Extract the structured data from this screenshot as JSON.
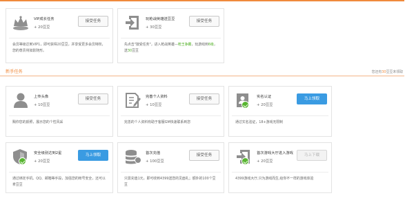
{
  "header": {
    "accent_color": "#f08a3c"
  },
  "top_tasks": [
    {
      "icon": "vip-crown-icon",
      "name": "VIP成长任务",
      "reward": "+ 20豆豆",
      "button": "接受任务",
      "desc": "会员等级达到VIP1，即可获得20豆豆，并享受更多会员特权，您的尊贵将如影随形。"
    },
    {
      "icon": "login-arrow-icon",
      "name": "玩枪战英雄送豆豆",
      "reward": "+ 30豆豆",
      "button": "接受任务",
      "desc_parts": [
        "先点击\"接受任务\"，进入枪战英雄—",
        "枪王争霸",
        "，玩游戏到",
        "6级",
        "，送",
        "30",
        "豆豆"
      ]
    }
  ],
  "newbie": {
    "title": "新手任务",
    "note_prefix": "您还有",
    "note_count": "30",
    "note_suffix": "豆豆未领取"
  },
  "tasks": [
    {
      "icon": "user-avatar-icon",
      "name": "上传头像",
      "reward": "+ 10豆豆",
      "button": "接受任务",
      "button_style": "default",
      "desc": "赐你您的颜照，展示您的个性风采"
    },
    {
      "icon": "edit-document-icon",
      "name": "完善个人资料",
      "reward": "+ 10豆豆",
      "button": "接受任务",
      "button_style": "default",
      "desc": "完善的个人资料有助于客服GM快速联系到您"
    },
    {
      "icon": "id-card-icon",
      "name": "实名认证",
      "reward": "+ 20豆豆",
      "button": "马上领取",
      "button_style": "blue",
      "completed": true,
      "desc": "通过实名验证，18+游戏无限制"
    },
    {
      "icon": "security-shield-icon",
      "name": "安全级别达到2星",
      "reward": "+ 20豆豆",
      "button": "马上领取",
      "button_style": "blue",
      "completed": true,
      "desc": "通过绑定手机、QQ、邮箱等手段，加强您的帐号安全，还可以拿豆豆"
    },
    {
      "icon": "coin-stack-icon",
      "name": "首次充值",
      "reward": "+ 100豆豆",
      "button": "接受任务",
      "button_style": "default",
      "desc": "只需充值1元，即可收到4399送您的见面礼；额外的100个豆豆"
    },
    {
      "icon": "game-entry-icon",
      "name": "首次游戏大厅进入游戏",
      "reward": "+ 20豆豆",
      "button": "马上下载",
      "button_style": "gray",
      "completed": true,
      "desc": "4399游戏大厅,只为游戏而生,给你不一样的游戏体验"
    }
  ]
}
